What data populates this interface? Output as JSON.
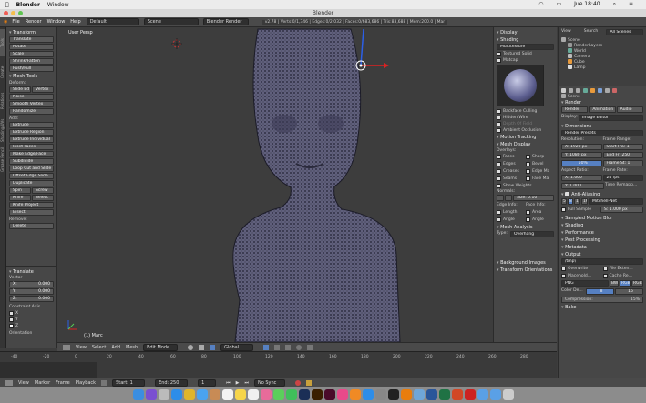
{
  "mac_menu": {
    "app": "Blender",
    "window": "Window",
    "time": "Jue 18:40"
  },
  "window_title": "Blender",
  "info_header": {
    "menus": [
      "File",
      "Render",
      "Window",
      "Help"
    ],
    "layout": "Default",
    "scene": "Scene",
    "engine": "Blender Render",
    "stats": "v2.78 | Verts:0/1,346 | Edges:0/2,032 | Faces:0/683,686 | Tris:83,688 | Mem:200.0 | Mar"
  },
  "tool_tabs": [
    "Tools",
    "Create",
    "Relations",
    "Shading/UVs",
    "Grease Pencil"
  ],
  "toolshelf": {
    "transform_title": "Transform",
    "transform": [
      "Translate",
      "Rotate",
      "Scale",
      "Shrink/Fatten",
      "Push/Pull"
    ],
    "mesh_tools_title": "Mesh Tools",
    "deform_label": "Deform:",
    "deform_pairs": [
      [
        "Slide Ed",
        "Vertex"
      ]
    ],
    "deform": [
      "Noise",
      "Smooth Vertex",
      "Randomize"
    ],
    "add_label": "Add:",
    "add": [
      "Extrude",
      "Extrude Region",
      "Extrude Individual",
      "Inset Faces",
      "Make Edge/Face",
      "Subdivide",
      "Loop Cut and Slide",
      "Offset Edge Slide",
      "Duplicate"
    ],
    "add_pairs": [
      [
        "Spin",
        "Screw"
      ],
      [
        "Knife",
        "Select"
      ]
    ],
    "add_more": [
      "Knife Project",
      "Bisect"
    ],
    "remove_label": "Remove:",
    "remove": [
      "Delete"
    ]
  },
  "redo_panel": {
    "title": "Translate",
    "vector_label": "Vector",
    "vector": [
      {
        "axis": "X:",
        "value": "0.000"
      },
      {
        "axis": "Y:",
        "value": "0.000"
      },
      {
        "axis": "Z:",
        "value": "0.000"
      }
    ],
    "constraint_label": "Constraint Axis",
    "axes": [
      "X",
      "Y",
      "Z"
    ],
    "orientation_label": "Orientation"
  },
  "viewport": {
    "label": "User Persp",
    "object": "(1) Marc"
  },
  "properties_panel": {
    "display": "Display",
    "shading": "Shading",
    "shading_mode": "Multitexture",
    "textured_solid": "Textured Solid",
    "matcap": "Matcap",
    "options": [
      "Backface Culling",
      "Hidden Wire",
      "Depth Of Field",
      "Ambient Occlusion"
    ],
    "motion_tracking": "Motion Tracking",
    "mesh_display": "Mesh Display",
    "overlays_label": "Overlays:",
    "overlays": [
      [
        "Faces",
        "Sharp"
      ],
      [
        "Edges",
        "Bevel"
      ],
      [
        "Creases",
        "Edge Ma"
      ],
      [
        "Seams",
        "Face Ma"
      ]
    ],
    "show_weights": "Show Weights",
    "normals_label": "Normals:",
    "normals_size": "Size: 0.10",
    "edge_info": "Edge Info:",
    "face_info": "Face Info:",
    "edge_opts": [
      "Length",
      "Angle"
    ],
    "face_opts": [
      "Area",
      "Angle"
    ],
    "mesh_analysis": "Mesh Analysis",
    "type_label": "Type:",
    "type_value": "Overhang",
    "background_images": "Background Images",
    "transform_orientations": "Transform Orientations"
  },
  "outliner": {
    "tabs": [
      "View",
      "Search",
      "All Scenes"
    ],
    "items": [
      "Scene",
      "RenderLayers",
      "World",
      "Camera",
      "Cube",
      "Lamp"
    ]
  },
  "render_props": {
    "scene": "Scene",
    "render": "Render",
    "render_btns": [
      "Render",
      "Animation",
      "Audio"
    ],
    "display_label": "Display:",
    "display_value": "Image Editor",
    "dimensions": "Dimensions",
    "presets": "Render Presets",
    "resolution": "Resolution:",
    "frame_range": "Frame Range:",
    "res_x": "X: 1920 px",
    "res_y": "Y: 1080 px",
    "res_pct": "50%",
    "start": "Start Fra: 1",
    "end": "End Fr: 250",
    "step": "Frame St: 1",
    "aspect": "Aspect Ratio:",
    "frame_rate": "Frame Rate:",
    "asp_x": "X: 1.000",
    "asp_y": "Y: 1.000",
    "fps": "24 fps",
    "time_remap": "Time Remapp...",
    "anti_aliasing": "Anti-Aliasing",
    "aa_samples": [
      "5",
      "8",
      "11",
      "16"
    ],
    "aa_filter": "Mitchell-Net",
    "full_sample": "Full Sample",
    "aa_size": "S: 1.000 px",
    "collapsed": [
      "Sampled Motion Blur",
      "Shading",
      "Performance",
      "Post Processing",
      "Metadata"
    ],
    "output": "Output",
    "output_path": "/tmp\\",
    "overwrite": "Overwrite",
    "file_ext": "File Exten...",
    "placeholders": "Placehold...",
    "cache": "Cache Re...",
    "format": "PNG",
    "color_modes": [
      "BW",
      "RGB",
      "RGBA"
    ],
    "color_depth_label": "Color De...",
    "color_depth": [
      "8",
      "16"
    ],
    "compression": "Compression:",
    "compression_value": "15%",
    "bake": "Bake"
  },
  "viewport_header": {
    "menus": [
      "View",
      "Select",
      "Add",
      "Mesh"
    ],
    "mode": "Edit Mode",
    "pivot": "Global"
  },
  "timeline": {
    "ticks": [
      "-40",
      "-20",
      "0",
      "20",
      "40",
      "60",
      "80",
      "100",
      "120",
      "140",
      "160",
      "180",
      "200",
      "220",
      "240",
      "260",
      "280"
    ],
    "menus": [
      "View",
      "Marker",
      "Frame",
      "Playback"
    ],
    "start": "Start:",
    "start_value": "1",
    "end": "End:",
    "end_value": "250",
    "current": "1",
    "sync": "No Sync"
  },
  "colors": {
    "accent_blue": "#5680c2",
    "header": "#4a4a4a",
    "panel": "#474747",
    "viewport": "#3d3d3d",
    "mesh": "#5b5a78"
  }
}
